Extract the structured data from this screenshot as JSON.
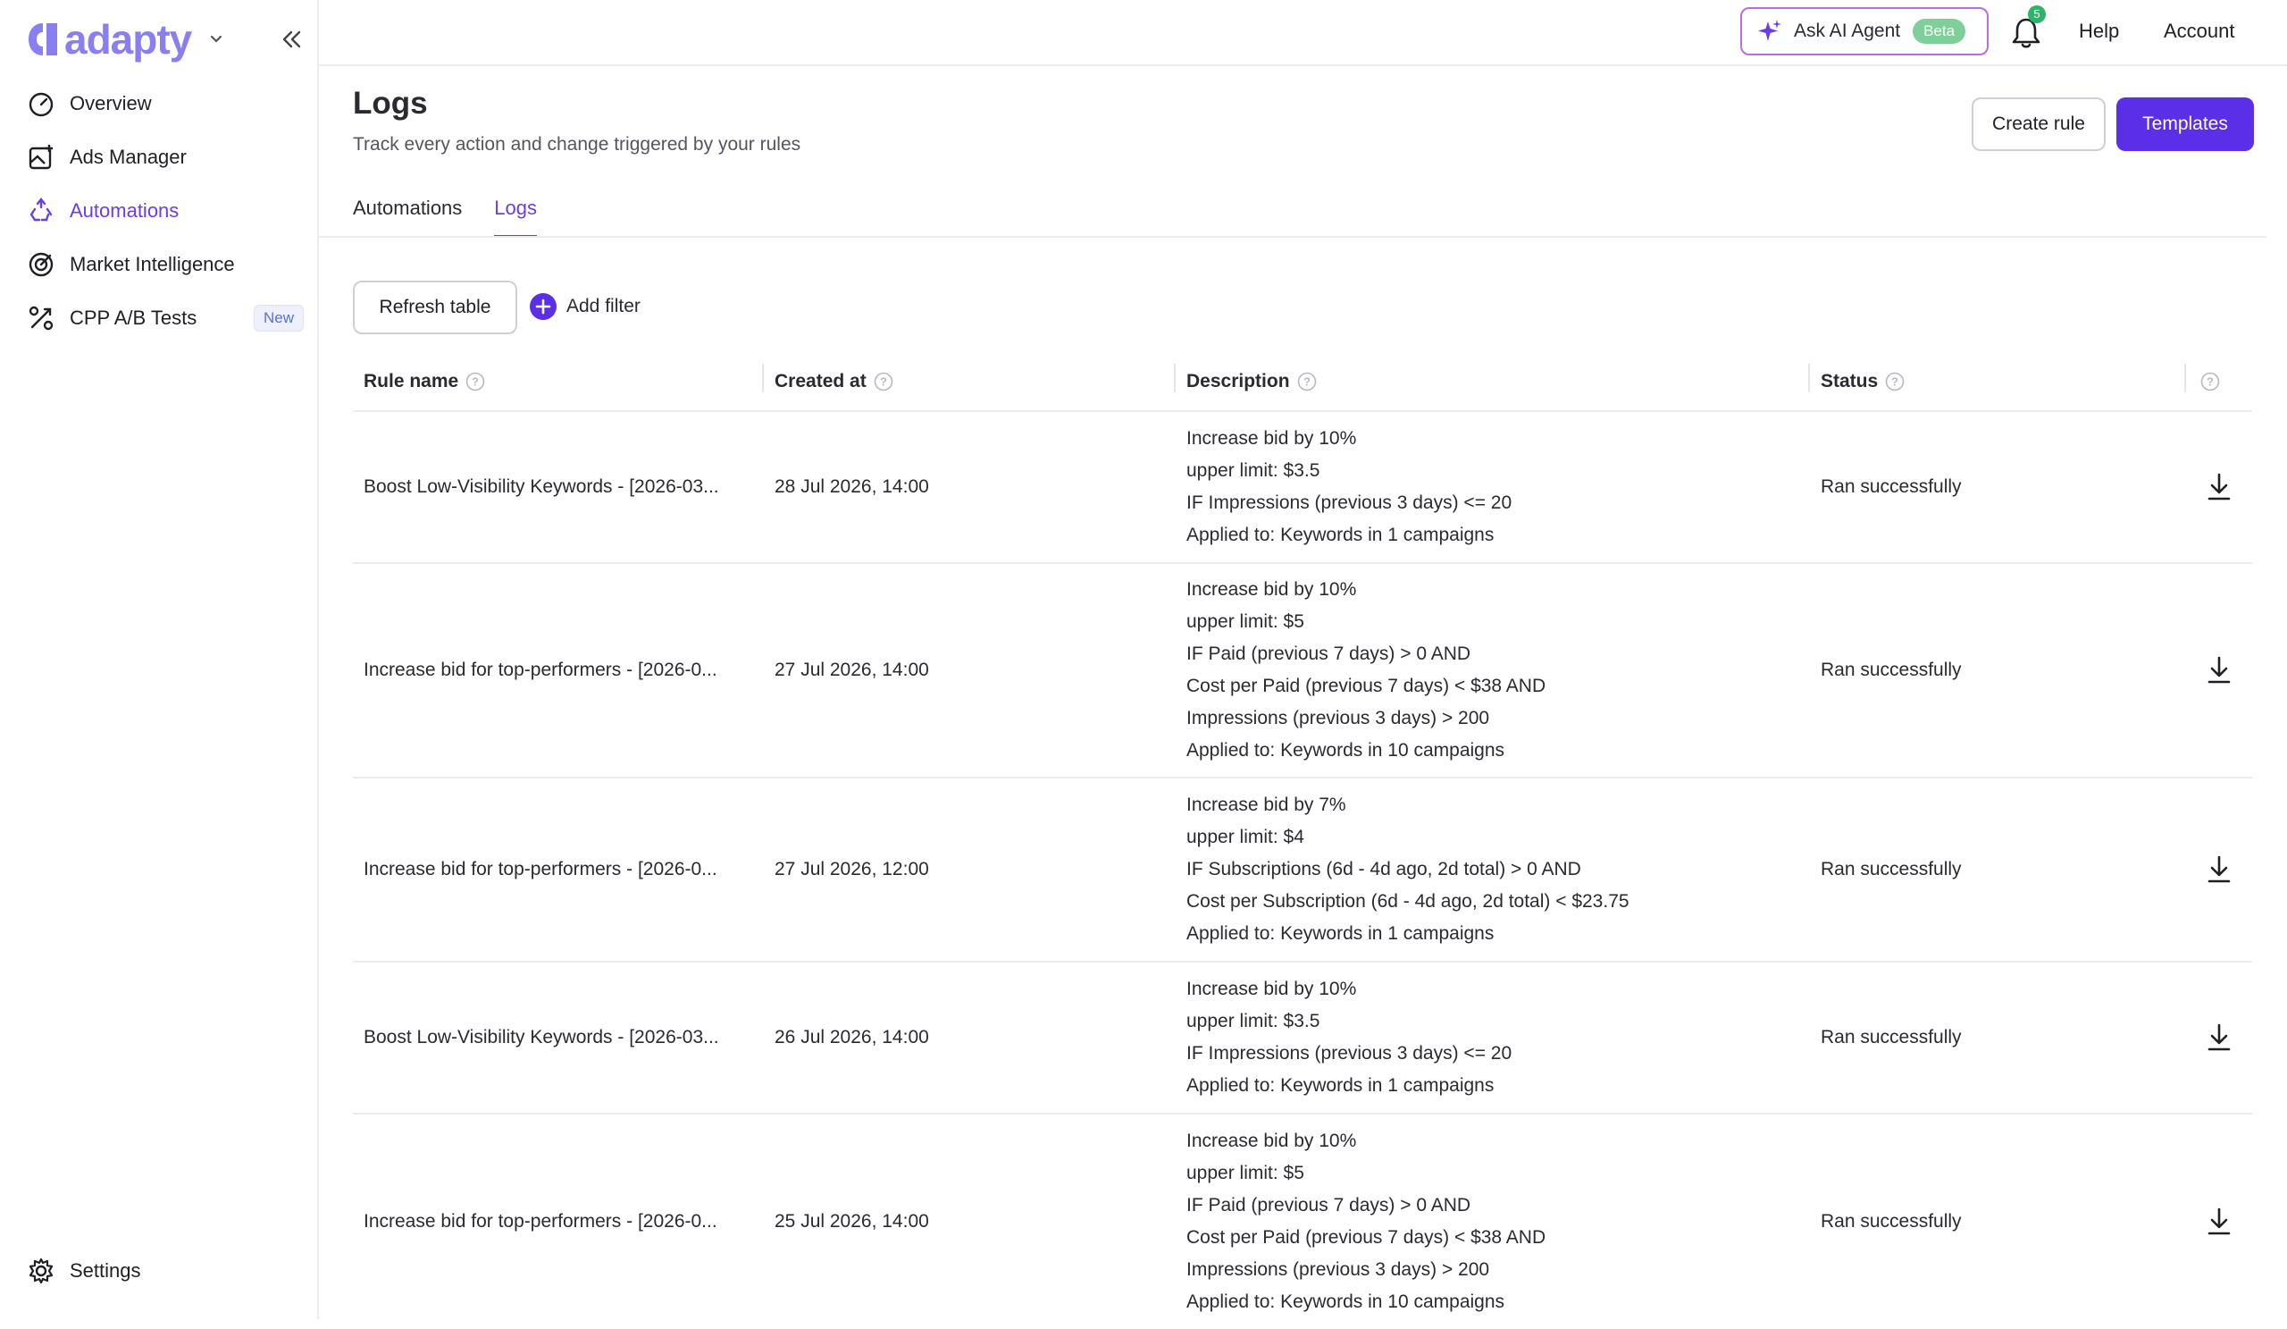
{
  "brand": {
    "name": "adapty"
  },
  "sidebar": {
    "items": [
      {
        "label": "Overview",
        "icon": "gauge-icon",
        "active": false
      },
      {
        "label": "Ads Manager",
        "icon": "ads-image-icon",
        "active": false
      },
      {
        "label": "Automations",
        "icon": "recycle-icon",
        "active": true
      },
      {
        "label": "Market Intelligence",
        "icon": "target-icon",
        "active": false
      },
      {
        "label": "CPP A/B Tests",
        "icon": "split-test-icon",
        "active": false,
        "badge": "New"
      }
    ],
    "settings_label": "Settings"
  },
  "header": {
    "ai_agent_label": "Ask AI Agent",
    "ai_agent_badge": "Beta",
    "notifications_count": "5",
    "help_label": "Help",
    "account_label": "Account"
  },
  "page": {
    "title": "Logs",
    "subtitle": "Track every action and change triggered by your rules",
    "create_rule_label": "Create rule",
    "templates_label": "Templates",
    "tabs": [
      {
        "label": "Automations",
        "active": false
      },
      {
        "label": "Logs",
        "active": true
      }
    ],
    "refresh_label": "Refresh table",
    "add_filter_label": "Add filter"
  },
  "table": {
    "columns": [
      "Rule name",
      "Created at",
      "Description",
      "Status"
    ],
    "rows": [
      {
        "rule_name": "Boost Low-Visibility Keywords - [2026-03...",
        "created_at": "28 Jul 2026, 14:00",
        "description": [
          "Increase bid by 10%",
          "upper limit: $3.5",
          "IF Impressions (previous 3 days) <= 20",
          "Applied to: Keywords in 1 campaigns"
        ],
        "status": "Ran successfully"
      },
      {
        "rule_name": "Increase bid for top-performers - [2026-0...",
        "created_at": "27 Jul 2026, 14:00",
        "description": [
          "Increase bid by 10%",
          "upper limit: $5",
          "IF Paid (previous 7 days) > 0 AND",
          "Cost per Paid (previous 7 days) < $38 AND",
          "Impressions (previous 3 days) > 200",
          "Applied to: Keywords in 10 campaigns"
        ],
        "status": "Ran successfully"
      },
      {
        "rule_name": "Increase bid for top-performers - [2026-0...",
        "created_at": "27 Jul 2026, 12:00",
        "description": [
          "Increase bid by 7%",
          "upper limit: $4",
          "IF Subscriptions (6d - 4d ago, 2d total) > 0 AND",
          "Cost per Subscription (6d - 4d ago, 2d total) < $23.75",
          "Applied to: Keywords in 1 campaigns"
        ],
        "status": "Ran successfully"
      },
      {
        "rule_name": "Boost Low-Visibility Keywords - [2026-03...",
        "created_at": "26 Jul 2026, 14:00",
        "description": [
          "Increase bid by 10%",
          "upper limit: $3.5",
          "IF Impressions (previous 3 days) <= 20",
          "Applied to: Keywords in 1 campaigns"
        ],
        "status": "Ran successfully"
      },
      {
        "rule_name": "Increase bid for top-performers - [2026-0...",
        "created_at": "25 Jul 2026, 14:00",
        "description": [
          "Increase bid by 10%",
          "upper limit: $5",
          "IF Paid (previous 7 days) > 0 AND",
          "Cost per Paid (previous 7 days) < $38 AND",
          "Impressions (previous 3 days) > 200",
          "Applied to: Keywords in 10 campaigns"
        ],
        "status": "Ran successfully"
      }
    ]
  },
  "colors": {
    "accent": "#5b2ee8",
    "active_nav": "#6b3de8",
    "brand": "#8a7ff0",
    "beta_badge": "#7fcf9a",
    "notification": "#2fb36a"
  }
}
